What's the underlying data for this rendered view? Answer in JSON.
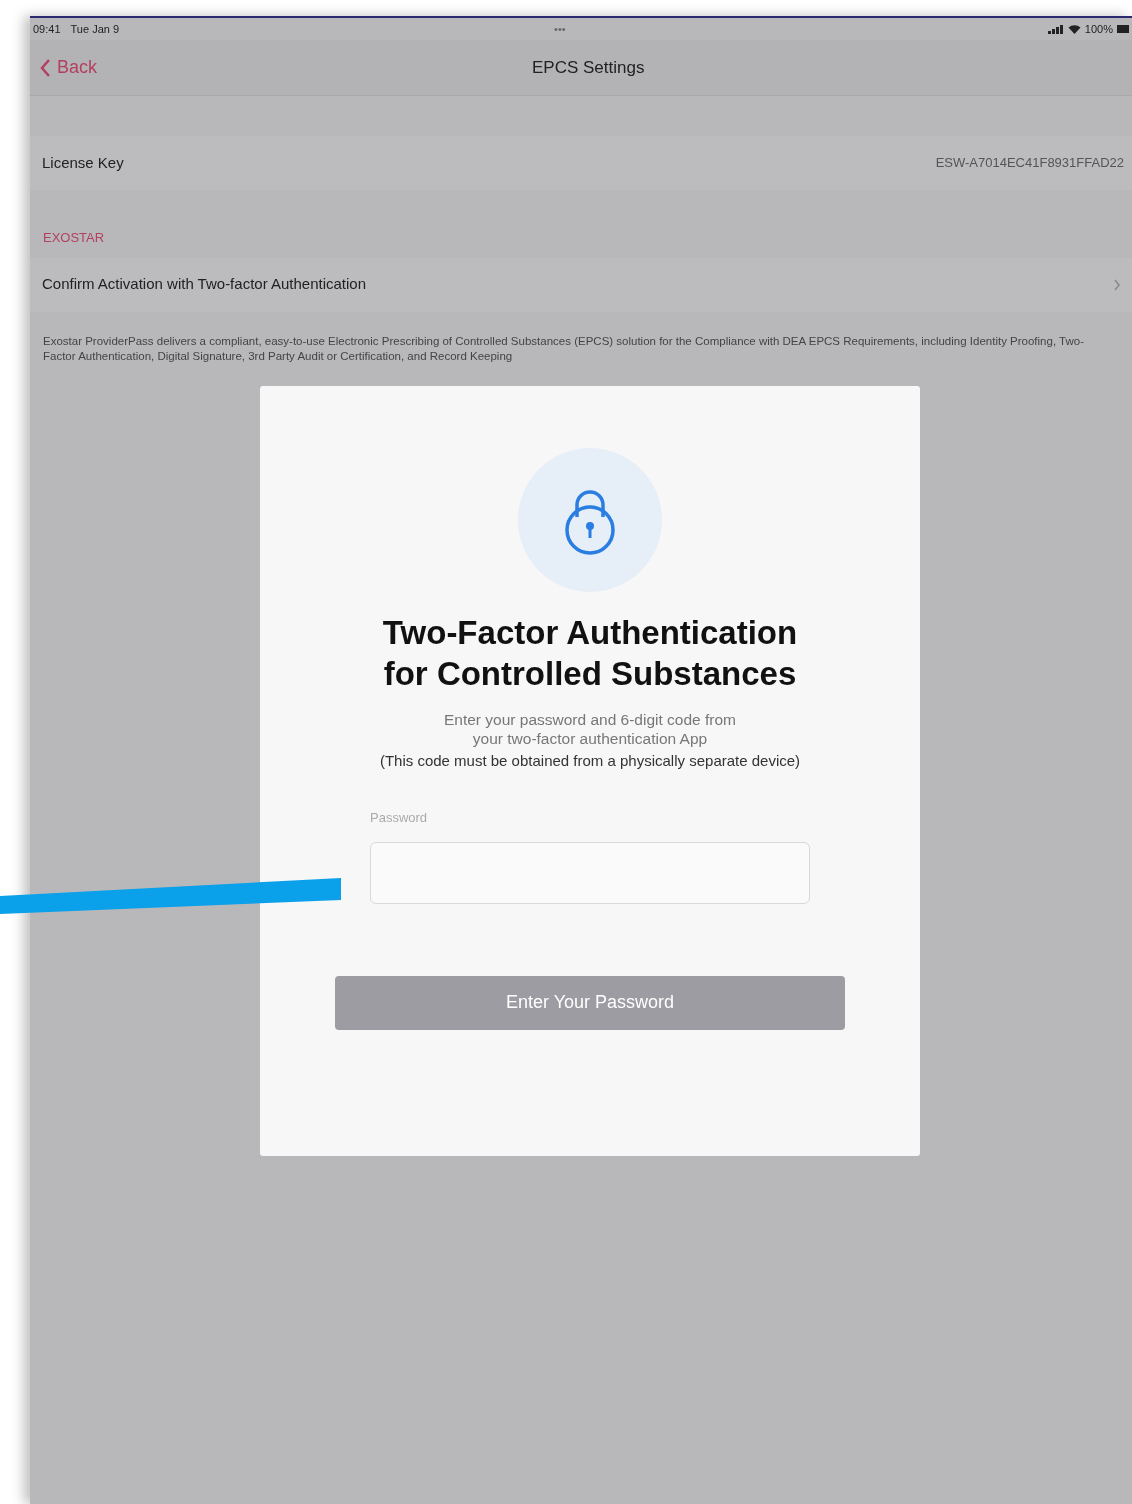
{
  "status_bar": {
    "time": "09:41",
    "date": "Tue Jan 9",
    "dots": "•••",
    "battery": "100%"
  },
  "nav_bar": {
    "back": "Back",
    "title": "EPCS Settings"
  },
  "license_row": {
    "label": "License Key",
    "value": "ESW-A7014EC41F8931FFAD22"
  },
  "section": {
    "header": "EXOSTAR",
    "row": "Confirm Activation with Two-factor Authentication",
    "footer": "Exostar ProviderPass delivers a compliant, easy-to-use Electronic Prescribing of Controlled Substances (EPCS) solution for the Compliance with DEA EPCS Requirements, including Identity Proofing, Two-Factor Authentication, Digital Signature, 3rd Party Audit or Certification, and Record Keeping"
  },
  "dialog": {
    "title": [
      "Two-Factor Authentication",
      "for Controlled Substances"
    ],
    "instructions": [
      "Enter your password and 6-digit code from",
      "your two-factor authentication App"
    ],
    "note": "(This code must be obtained from a physically separate device)",
    "field_label": "Password",
    "button": {
      "label": "Enter Your Password",
      "disabled": true
    }
  }
}
